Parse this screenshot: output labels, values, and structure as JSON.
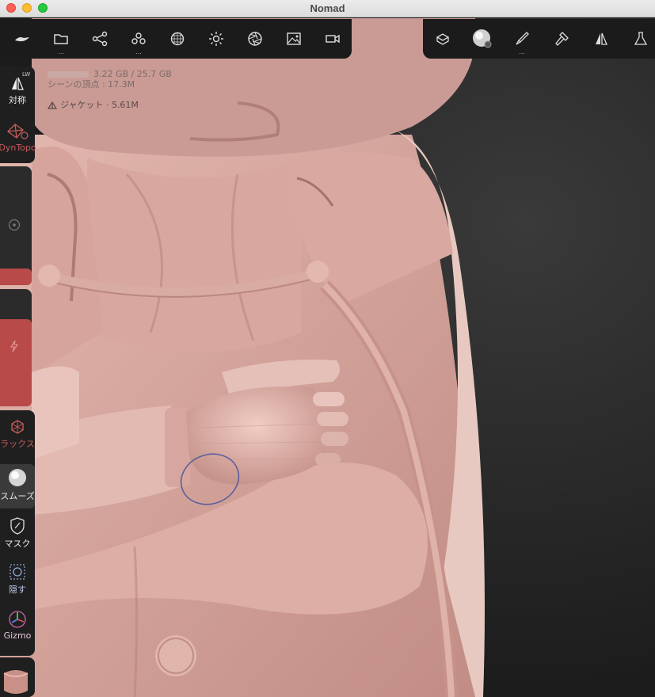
{
  "window": {
    "title": "Nomad"
  },
  "toolbar_left": {
    "buttons": [
      {
        "icon": "nomad-logo-icon",
        "dots": ""
      },
      {
        "icon": "folder-icon",
        "dots": "..."
      },
      {
        "icon": "scene-graph-icon",
        "dots": ""
      },
      {
        "icon": "primitives-icon",
        "dots": "..."
      },
      {
        "icon": "topology-icon",
        "dots": ""
      },
      {
        "icon": "light-icon",
        "dots": ""
      },
      {
        "icon": "camera-aperture-icon",
        "dots": ""
      },
      {
        "icon": "image-icon",
        "dots": ""
      },
      {
        "icon": "video-camera-icon",
        "dots": ""
      }
    ]
  },
  "toolbar_right": {
    "buttons": [
      {
        "icon": "layers-box-icon",
        "dots": ""
      },
      {
        "icon": "material-sphere-icon",
        "dots": ""
      },
      {
        "icon": "paint-brush-icon",
        "dots": "..."
      },
      {
        "icon": "hammer-icon",
        "dots": ""
      },
      {
        "icon": "symmetry-icon",
        "dots": ""
      },
      {
        "icon": "flask-icon",
        "dots": ""
      }
    ]
  },
  "info": {
    "memory": "3.22 GB / 25.7 GB",
    "vertices": "シーンの頂点 : 17.3M",
    "layer": "ジャケット · 5.61M"
  },
  "side": {
    "symmetry_label": "対称",
    "symmetry_tag": "LW",
    "dyntopo_label": "DynTopo",
    "relax_label": "ラックス",
    "smooth_label": "スムーズ",
    "mask_label": "マスク",
    "hide_label": "隠す",
    "gizmo_label": "Gizmo"
  },
  "sliders": {
    "radius_fraction": 0.14,
    "intensity_fraction": 0.74
  },
  "colors": {
    "accent": "#b84a4a",
    "clay": "#d4a59d",
    "toolbar": "#1b1b1b"
  }
}
